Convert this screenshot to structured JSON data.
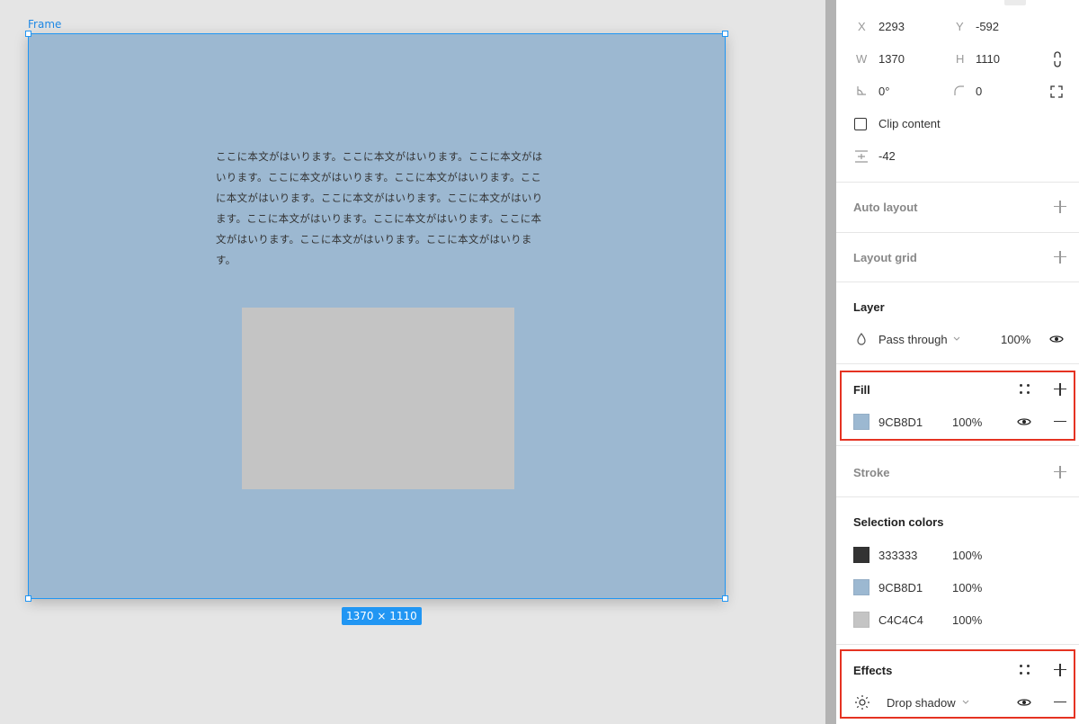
{
  "canvas": {
    "frame_label": "Frame",
    "size_badge": "1370 × 1110",
    "body_text": "ここに本文がはいります。ここに本文がはいります。ここに本文がはいります。ここに本文がはいります。ここに本文がはいります。ここに本文がはいります。ここに本文がはいります。ここに本文がはいります。ここに本文がはいります。ここに本文がはいります。ここに本文がはいります。ここに本文がはいります。ここに本文がはいります。",
    "frame_fill": "#9CB8D1",
    "rect_fill": "#C4C4C4"
  },
  "design": {
    "x_label": "X",
    "x_value": "2293",
    "y_label": "Y",
    "y_value": "-592",
    "w_label": "W",
    "w_value": "1370",
    "h_label": "H",
    "h_value": "1110",
    "rotation_value": "0°",
    "radius_value": "0",
    "clip_content_label": "Clip content",
    "spacing_value": "-42"
  },
  "sections": {
    "auto_layout": "Auto layout",
    "layout_grid": "Layout grid",
    "layer": "Layer",
    "fill": "Fill",
    "stroke": "Stroke",
    "selection_colors": "Selection colors",
    "effects": "Effects"
  },
  "layer": {
    "blend_mode": "Pass through",
    "opacity": "100%"
  },
  "fill": {
    "hex": "9CB8D1",
    "opacity": "100%",
    "color": "#9CB8D1"
  },
  "selection_colors": [
    {
      "hex": "333333",
      "opacity": "100%",
      "color": "#333333"
    },
    {
      "hex": "9CB8D1",
      "opacity": "100%",
      "color": "#9CB8D1"
    },
    {
      "hex": "C4C4C4",
      "opacity": "100%",
      "color": "#C4C4C4"
    }
  ],
  "effects": {
    "type": "Drop shadow"
  },
  "accent": "#2196F3",
  "highlight_color": "#E53322"
}
